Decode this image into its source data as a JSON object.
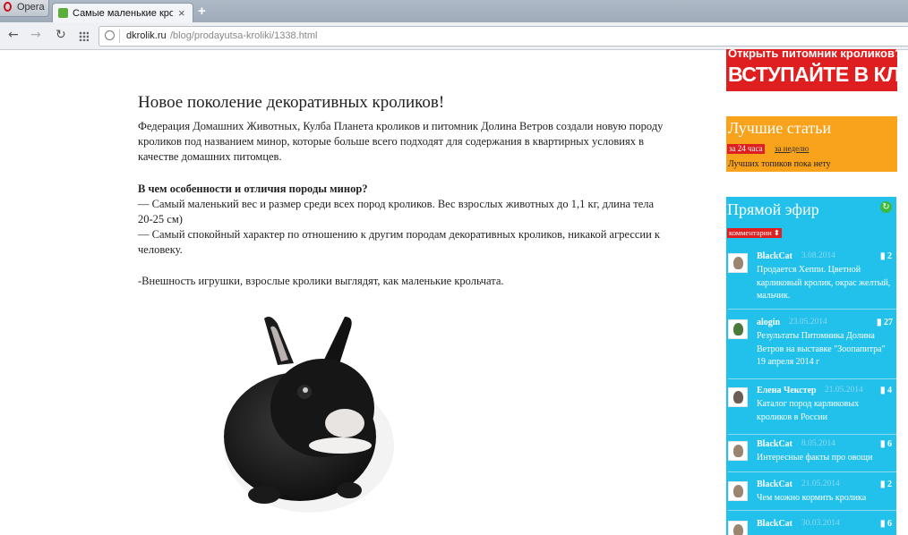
{
  "browser": {
    "app_menu_label": "Opera",
    "tab_title": "Самые маленькие кролики",
    "tab_close": "×",
    "new_tab": "+",
    "url_domain": "dkrolik.ru",
    "url_path": "/blog/prodayutsa-kroliki/1338.html"
  },
  "article": {
    "title": "Новое поколение декоративных кроликов!",
    "intro": "Федерация Домашних Животных, Кулба Планета кроликов и питомник Долина Ветров создали новую породу кроликов под названием минор, которые больше всего подходят для содержания в квартирных условиях в качестве домашних питомцев.",
    "features_heading": "В чем особенности и отличия породы минор?",
    "feature1": "— Самый маленький вес и размер среди всех пород кроликов. Вес взрослых животных до 1,1 кг, длина тела 20-25 см)",
    "feature2": "— Самый спокойный характер по отношению к другим породам декоративных кроликов, никакой агрессии к человеку.",
    "feature3": "-Внешность игрушки, взрослые кролики выглядят, как маленькие крольчата."
  },
  "banner": {
    "line1": "Открыть питомник кроликов?",
    "line2": "ВСТУПАЙТЕ В КЛУБ!"
  },
  "best_articles": {
    "title": "Лучшие статьи",
    "tab_day": "за 24 часа",
    "tab_week": "за неделю",
    "empty": "Лучших топиков пока нету"
  },
  "live": {
    "title": "Прямой эфир",
    "filter": "комментарии ⬍",
    "items": [
      {
        "user": "BlackCat",
        "date": "3.08.2014",
        "count": "2",
        "text": "Продается Хеппи. Цветной карликовый кролик, окрас желтый, мальчик."
      },
      {
        "user": "alogin",
        "date": "23.05.2014",
        "count": "27",
        "text": "Результаты Питомника Долина Ветров на выставке \"Зоопапитра\" 19 апреля 2014 г"
      },
      {
        "user": "Елена Чекстер",
        "date": "21.05.2014",
        "count": "4",
        "text": "Каталог пород карликовых кроликов в России"
      },
      {
        "user": "BlackCat",
        "date": "8.05.2014",
        "count": "6",
        "text": "Интересные факты про овощи"
      },
      {
        "user": "BlackCat",
        "date": "21.05.2014",
        "count": "2",
        "text": "Чем можно кормить кролика"
      },
      {
        "user": "BlackCat",
        "date": "30.03.2014",
        "count": "6",
        "text": ""
      }
    ]
  }
}
